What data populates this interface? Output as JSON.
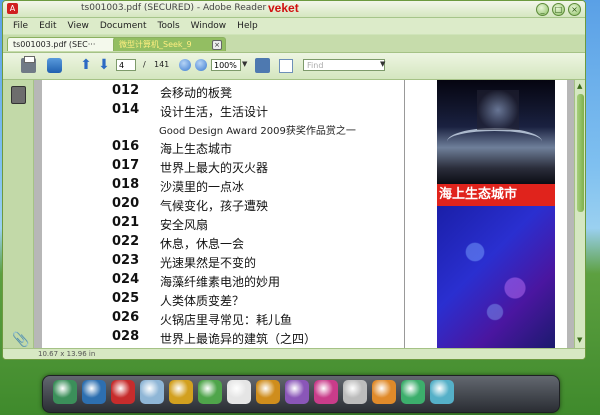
{
  "window": {
    "title": "ts001003.pdf (SECURED) - Adobe Reader",
    "tag": "veket",
    "controls": [
      "_",
      "□",
      "×"
    ]
  },
  "menu": [
    "File",
    "Edit",
    "View",
    "Document",
    "Tools",
    "Window",
    "Help"
  ],
  "tabs": [
    {
      "label": "ts001003.pdf (SEC···",
      "active": true
    },
    {
      "label": "微型计算机_Seek_9",
      "active": false
    }
  ],
  "toolbar": {
    "page_value": "4",
    "page_sep": "/",
    "page_total": "141",
    "zoom": "100%",
    "find_placeholder": "Find"
  },
  "toc": [
    {
      "num": "012",
      "title": "会移动的板凳"
    },
    {
      "num": "014",
      "title": "设计生活，生活设计"
    },
    {
      "num": "",
      "title": "Good Design Award 2009获奖作品赏之一"
    },
    {
      "num": "016",
      "title": "海上生态城市"
    },
    {
      "num": "017",
      "title": "世界上最大的灭火器"
    },
    {
      "num": "018",
      "title": "沙漠里的一点冰"
    },
    {
      "num": "020",
      "title": "气候变化，孩子遭殃"
    },
    {
      "num": "021",
      "title": "安全风扇"
    },
    {
      "num": "022",
      "title": "休息，休息一会"
    },
    {
      "num": "023",
      "title": "光速果然是不变的"
    },
    {
      "num": "024",
      "title": "海藻纤维素电池的妙用"
    },
    {
      "num": "025",
      "title": "人类体质变差？"
    },
    {
      "num": "026",
      "title": "火锅店里寻常见：耗儿鱼"
    },
    {
      "num": "028",
      "title": "世界上最诡异的建筑（之四）"
    }
  ],
  "photo_caption": "海上生态城市",
  "status": {
    "page_size": "10.67 x 13.96 in"
  },
  "dock": {
    "icons": [
      "desktop-icon",
      "monitor-icon",
      "bug-icon",
      "document-icon",
      "clock-icon",
      "network-icon",
      "penguin-icon",
      "folder-door-icon",
      "image-icon",
      "palette-icon",
      "pen-icon",
      "game-icon",
      "app-icon",
      "settings-icon"
    ],
    "colors": [
      "#3b8f5a",
      "#2d6fb0",
      "#c62c2c",
      "#8fb6d6",
      "#d2a01f",
      "#4fa54a",
      "#e5e5e5",
      "#cf8d1c",
      "#8a56b8",
      "#c93c8a",
      "#bcbcbc",
      "#e08a2a",
      "#3cae6c",
      "#55b0c8"
    ]
  }
}
